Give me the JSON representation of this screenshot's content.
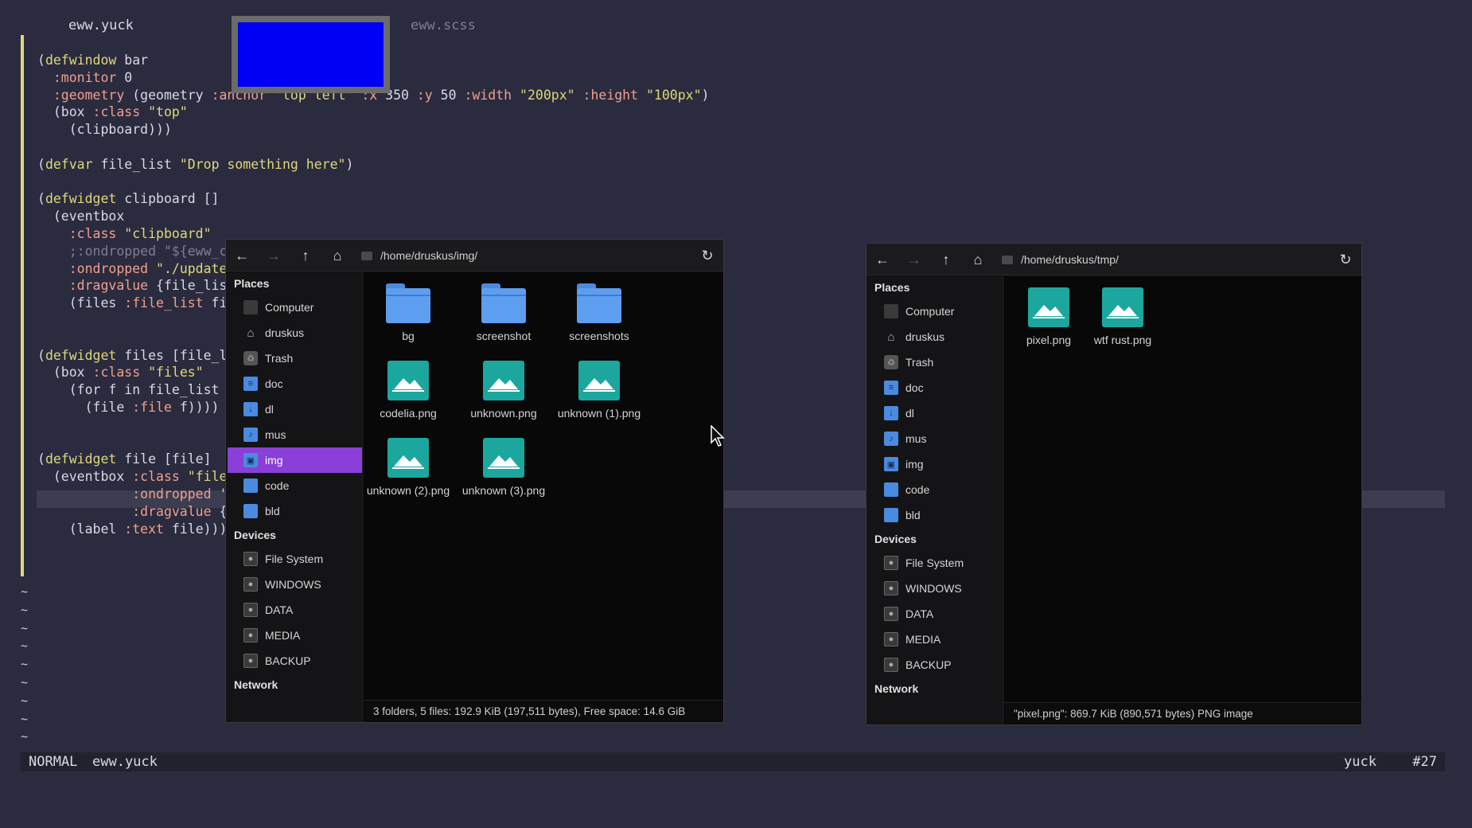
{
  "editor": {
    "tabs": [
      {
        "label": "eww.yuck",
        "active": true
      },
      {
        "label": "eww.scss",
        "active": false
      }
    ],
    "lines": [
      [
        [
          "(",
          "p"
        ],
        [
          "defwindow",
          "k"
        ],
        [
          " bar",
          "p"
        ]
      ],
      [
        [
          "  :monitor",
          "y"
        ],
        [
          " 0",
          "p"
        ]
      ],
      [
        [
          "  :geometry",
          "y"
        ],
        [
          " (geometry ",
          "p"
        ],
        [
          ":anchor",
          "y"
        ],
        [
          " \"top left\" ",
          "s"
        ],
        [
          ":x",
          "y"
        ],
        [
          " 350 ",
          "p"
        ],
        [
          ":y",
          "y"
        ],
        [
          " 50 ",
          "p"
        ],
        [
          ":width",
          "y"
        ],
        [
          " \"200px\" ",
          "s"
        ],
        [
          ":height",
          "y"
        ],
        [
          " \"100px\"",
          "s"
        ],
        [
          ")",
          "p"
        ]
      ],
      [
        [
          "  (box ",
          "p"
        ],
        [
          ":class",
          "y"
        ],
        [
          " \"top\"",
          "s"
        ]
      ],
      [
        [
          "    (clipboard)))",
          "p"
        ]
      ],
      [
        [
          "",
          "p"
        ]
      ],
      [
        [
          "(",
          "p"
        ],
        [
          "defvar",
          "k"
        ],
        [
          " file_list ",
          "p"
        ],
        [
          "\"Drop something here\"",
          "s"
        ],
        [
          ")",
          "p"
        ]
      ],
      [
        [
          "",
          "p"
        ]
      ],
      [
        [
          "(",
          "p"
        ],
        [
          "defwidget",
          "k"
        ],
        [
          " clipboard []",
          "p"
        ]
      ],
      [
        [
          "  (eventbox",
          "p"
        ]
      ],
      [
        [
          "    :class",
          "y"
        ],
        [
          " \"clipboard\"",
          "s"
        ]
      ],
      [
        [
          "    ;:ondropped \"${eww_c",
          "c"
        ]
      ],
      [
        [
          "    :ondropped",
          "y"
        ],
        [
          " \"./update",
          "s"
        ]
      ],
      [
        [
          "    :dragvalue",
          "y"
        ],
        [
          " {file_lis",
          "p"
        ]
      ],
      [
        [
          "    (files ",
          "p"
        ],
        [
          ":file_list",
          "y"
        ],
        [
          " fi",
          "p"
        ]
      ],
      [
        [
          "",
          "p"
        ]
      ],
      [
        [
          "",
          "p"
        ]
      ],
      [
        [
          "(",
          "p"
        ],
        [
          "defwidget",
          "k"
        ],
        [
          " files [file_l",
          "p"
        ]
      ],
      [
        [
          "  (box ",
          "p"
        ],
        [
          ":class",
          "y"
        ],
        [
          " \"files\"",
          "s"
        ]
      ],
      [
        [
          "    (for f in file_list",
          "p"
        ]
      ],
      [
        [
          "      (file ",
          "p"
        ],
        [
          ":file",
          "y"
        ],
        [
          " f))))",
          "p"
        ]
      ],
      [
        [
          "",
          "p"
        ]
      ],
      [
        [
          "",
          "p"
        ]
      ],
      [
        [
          "(",
          "p"
        ],
        [
          "defwidget",
          "k"
        ],
        [
          " file [file]",
          "p"
        ]
      ],
      [
        [
          "  (eventbox ",
          "p"
        ],
        [
          ":class",
          "y"
        ],
        [
          " \"file",
          "s"
        ]
      ],
      [
        [
          "            :ondropped",
          "y"
        ],
        [
          " '",
          "s"
        ]
      ],
      [
        [
          "            :dragvalue",
          "y"
        ],
        [
          " {",
          "p"
        ]
      ],
      [
        [
          "    (label ",
          "p"
        ],
        [
          ":text",
          "y"
        ],
        [
          " file)))",
          "p"
        ]
      ]
    ],
    "tildes": [
      "~",
      "~",
      "~",
      "~",
      "~",
      "~",
      "~",
      "~",
      "~",
      "~"
    ],
    "status": {
      "mode": "NORMAL",
      "file": "eww.yuck",
      "filetype": "yuck",
      "position": "#27"
    }
  },
  "fm_left": {
    "path": "/home/druskus/img/",
    "sidebar": {
      "places_header": "Places",
      "places": [
        {
          "label": "Computer",
          "icon": "computer-icon"
        },
        {
          "label": "druskus",
          "icon": "home-icon"
        },
        {
          "label": "Trash",
          "icon": "trash-icon"
        },
        {
          "label": "doc",
          "icon": "folder-documents-icon"
        },
        {
          "label": "dl",
          "icon": "folder-download-icon"
        },
        {
          "label": "mus",
          "icon": "folder-music-icon"
        },
        {
          "label": "img",
          "icon": "folder-pictures-icon",
          "active": true
        },
        {
          "label": "code",
          "icon": "folder-icon"
        },
        {
          "label": "bld",
          "icon": "folder-icon"
        }
      ],
      "devices_header": "Devices",
      "devices": [
        {
          "label": "File System"
        },
        {
          "label": "WINDOWS"
        },
        {
          "label": "DATA"
        },
        {
          "label": "MEDIA"
        },
        {
          "label": "BACKUP"
        }
      ],
      "network_header": "Network"
    },
    "items": [
      {
        "name": "bg",
        "type": "folder"
      },
      {
        "name": "screenshot",
        "type": "folder"
      },
      {
        "name": "screenshots",
        "type": "folder"
      },
      {
        "name": "codelia.png",
        "type": "image"
      },
      {
        "name": "unknown.png",
        "type": "image"
      },
      {
        "name": "unknown (1).png",
        "type": "image"
      },
      {
        "name": "unknown (2).png",
        "type": "image"
      },
      {
        "name": "unknown (3).png",
        "type": "image"
      }
    ],
    "status": "3 folders, 5 files: 192.9 KiB (197,511 bytes), Free space: 14.6 GiB"
  },
  "fm_right": {
    "path": "/home/druskus/tmp/",
    "sidebar": {
      "places_header": "Places",
      "places": [
        {
          "label": "Computer",
          "icon": "computer-icon"
        },
        {
          "label": "druskus",
          "icon": "home-icon"
        },
        {
          "label": "Trash",
          "icon": "trash-icon"
        },
        {
          "label": "doc",
          "icon": "folder-documents-icon"
        },
        {
          "label": "dl",
          "icon": "folder-download-icon"
        },
        {
          "label": "mus",
          "icon": "folder-music-icon"
        },
        {
          "label": "img",
          "icon": "folder-pictures-icon"
        },
        {
          "label": "code",
          "icon": "folder-icon"
        },
        {
          "label": "bld",
          "icon": "folder-icon"
        }
      ],
      "devices_header": "Devices",
      "devices": [
        {
          "label": "File System"
        },
        {
          "label": "WINDOWS"
        },
        {
          "label": "DATA"
        },
        {
          "label": "MEDIA"
        },
        {
          "label": "BACKUP"
        }
      ],
      "network_header": "Network"
    },
    "items": [
      {
        "name": "pixel.png",
        "type": "image"
      },
      {
        "name": "wtf rust.png",
        "type": "image"
      }
    ],
    "status": "\"pixel.png\": 869.7 KiB (890,571 bytes) PNG image"
  },
  "colors": {
    "background": "#2b2b3f",
    "eww_widget_fill": "#0000f5",
    "sidebar_active": "#8a3fd8",
    "folder_blue": "#5e9ef0",
    "image_teal": "#1ba79e"
  }
}
